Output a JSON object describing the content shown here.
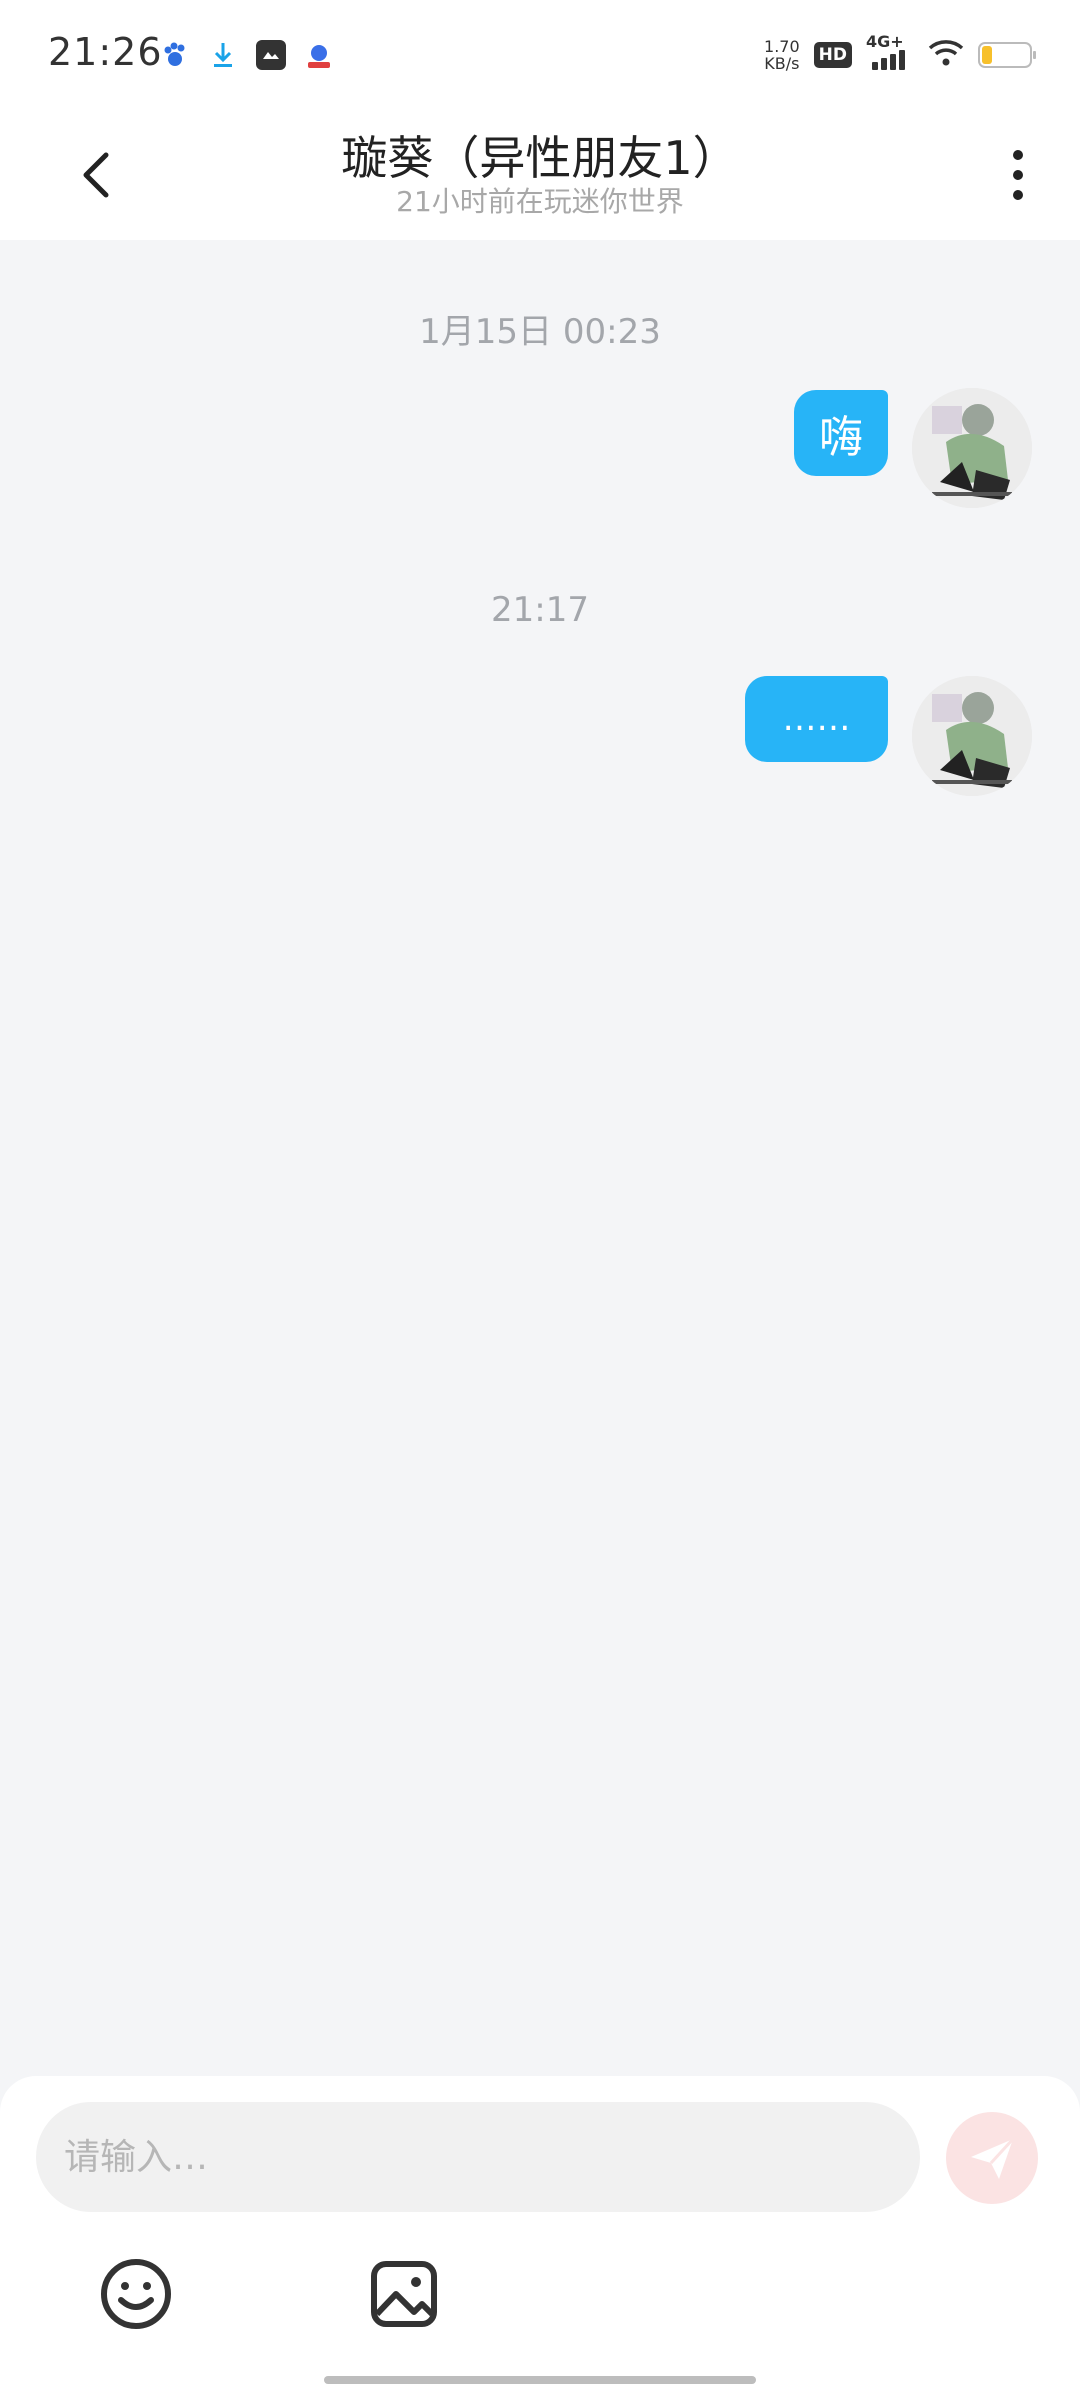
{
  "status_bar": {
    "time": "21:26",
    "net_speed_value": "1.70",
    "net_speed_unit": "KB/s",
    "hd_badge": "HD",
    "network_type": "4G+",
    "icons": [
      "baidu-icon",
      "download-icon",
      "gallery-icon",
      "baidu-netdisk-icon",
      "hd-icon",
      "signal-icon",
      "wifi-icon",
      "battery-icon"
    ],
    "battery_level": 0.2
  },
  "header": {
    "title": "璇葵（异性朋友1）",
    "subtitle": "21小时前在玩迷你世界",
    "icons": [
      "back-arrow-icon",
      "more-vertical-icon"
    ]
  },
  "chat": {
    "messages": [
      {
        "timestamp": "1月15日 00:23",
        "text": "嗨",
        "from": "me"
      },
      {
        "timestamp": "21:17",
        "text": "……",
        "from": "me"
      }
    ],
    "bubble_color": "#27b4f7"
  },
  "composer": {
    "placeholder": "请输入…",
    "value": "",
    "icons": [
      "send-icon",
      "emoji-icon",
      "image-icon"
    ]
  }
}
